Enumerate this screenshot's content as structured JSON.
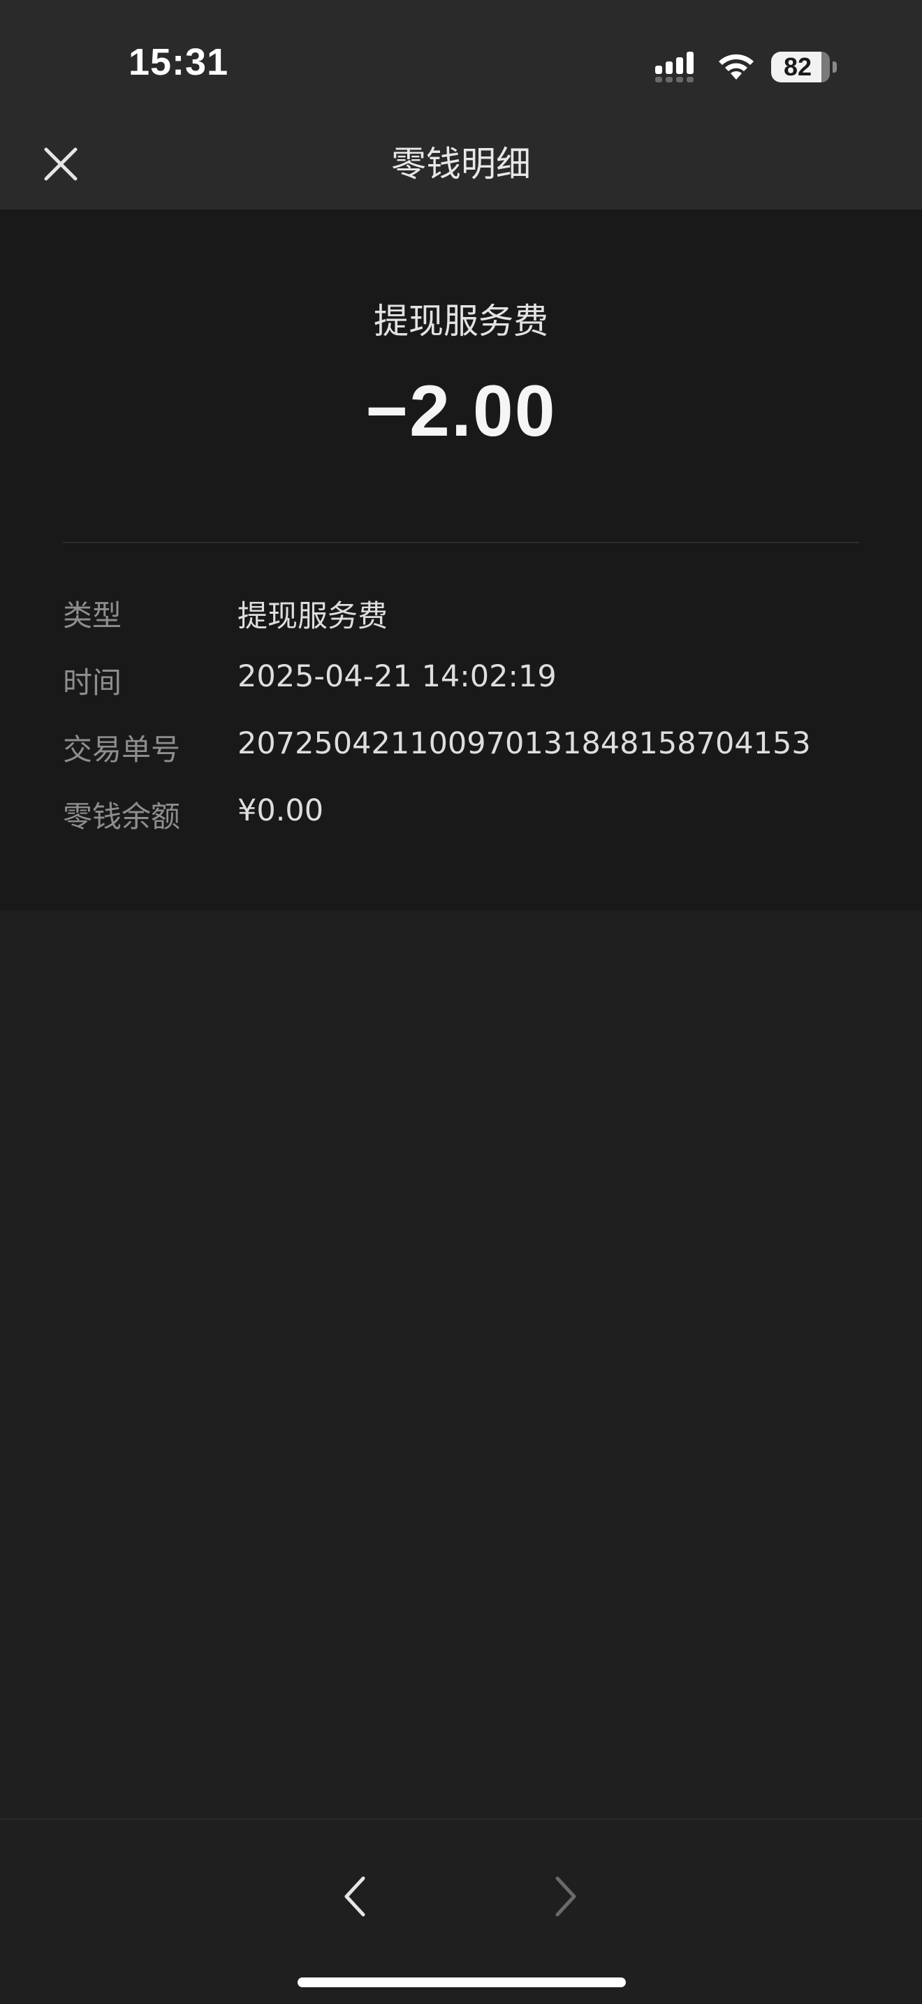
{
  "status_bar": {
    "time": "15:31",
    "battery_level": "82",
    "icons": [
      "signal-icon",
      "wifi-icon",
      "battery-icon"
    ]
  },
  "nav": {
    "title": "零钱明细",
    "close_icon": "close-icon"
  },
  "summary": {
    "label": "提现服务费",
    "amount": "−2.00"
  },
  "details": [
    {
      "label": "类型",
      "value": "提现服务费"
    },
    {
      "label": "时间",
      "value": "2025-04-21 14:02:19"
    },
    {
      "label": "交易单号",
      "value": "20725042110097013184815870415​3"
    },
    {
      "label": "零钱余额",
      "value": "¥0.00"
    }
  ],
  "bottom_nav": {
    "back_icon": "chevron-left-icon",
    "forward_icon": "chevron-right-icon",
    "forward_enabled": false
  },
  "colors": {
    "background": "#1f1f1f",
    "header": "#2a2a2a",
    "card": "#191919"
  }
}
